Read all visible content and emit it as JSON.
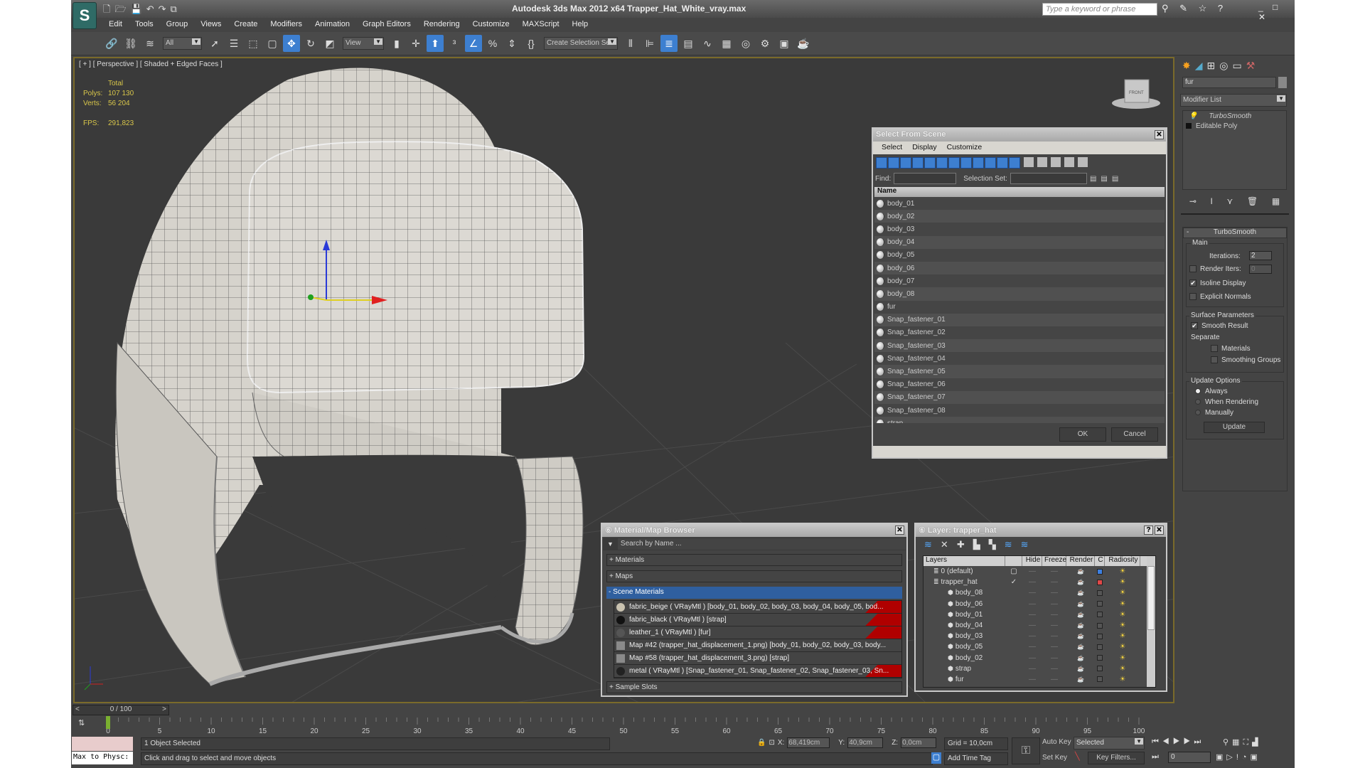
{
  "app": {
    "title": "Autodesk 3ds Max  2012 x64     Trapper_Hat_White_vray.max",
    "logo": "S",
    "search_placeholder": "Type a keyword or phrase",
    "quick_access": [
      "new-file-icon",
      "open-file-icon",
      "save-icon",
      "undo-icon",
      "redo-icon",
      "project-icon"
    ],
    "menu": [
      "Edit",
      "Tools",
      "Group",
      "Views",
      "Create",
      "Modifiers",
      "Animation",
      "Graph Editors",
      "Rendering",
      "Customize",
      "MAXScript",
      "Help"
    ],
    "toolbar": {
      "filter": "All",
      "ref_coord": "View",
      "selection_set": "Create Selection Se"
    }
  },
  "viewport": {
    "label": "[ + ] [ Perspective ] [ Shaded + Edged Faces ]",
    "stats": {
      "total": "Total",
      "polys_label": "Polys:",
      "polys": "107 130",
      "verts_label": "Verts:",
      "verts": "56 204",
      "fps_label": "FPS:",
      "fps": "291,823"
    },
    "viewcube": "FRONT"
  },
  "command_panel": {
    "object_name": "fur",
    "modifier_list": "Modifier List",
    "stack": [
      "TurboSmooth",
      "Editable Poly"
    ],
    "turbosmooth": {
      "title": "TurboSmooth",
      "main": "Main",
      "iterations_label": "Iterations:",
      "iterations": "2",
      "render_iters_label": "Render Iters:",
      "render_iters": "0",
      "isoline": "Isoline Display",
      "isoline_checked": true,
      "explicit_normals": "Explicit Normals",
      "surface": "Surface Parameters",
      "smooth_result": "Smooth Result",
      "separate": "Separate",
      "materials": "Materials",
      "smoothing_groups": "Smoothing Groups",
      "update_options": "Update Options",
      "always": "Always",
      "when_rendering": "When Rendering",
      "manually": "Manually",
      "update": "Update"
    }
  },
  "select_dialog": {
    "title": "Select From Scene",
    "menus": [
      "Select",
      "Display",
      "Customize"
    ],
    "find_label": "Find:",
    "selection_set_label": "Selection Set:",
    "column": "Name",
    "items": [
      "body_01",
      "body_02",
      "body_03",
      "body_04",
      "body_05",
      "body_06",
      "body_07",
      "body_08",
      "fur",
      "Snap_fastener_01",
      "Snap_fastener_02",
      "Snap_fastener_03",
      "Snap_fastener_04",
      "Snap_fastener_05",
      "Snap_fastener_06",
      "Snap_fastener_07",
      "Snap_fastener_08",
      "strap"
    ],
    "ok": "OK",
    "cancel": "Cancel"
  },
  "material_browser": {
    "title": "Material/Map Browser",
    "search_placeholder": "Search by Name ...",
    "groups": [
      "+ Materials",
      "+ Maps"
    ],
    "scene_group": "- Scene Materials",
    "sample_slots": "+ Sample Slots",
    "items": [
      {
        "text": "fabric_beige  ( VRayMtl ) [body_01, body_02, body_03, body_04, body_05, bod...",
        "red": true,
        "swatch": "#c9c2b0"
      },
      {
        "text": "fabric_black  ( VRayMtl ) [strap]",
        "red": true,
        "swatch": "#111111"
      },
      {
        "text": "leather_1  ( VRayMtl ) [fur]",
        "red": true,
        "swatch": "#555555"
      },
      {
        "text": "Map #42 (trapper_hat_displacement_1.png) [body_01, body_02, body_03, body...",
        "red": false,
        "swatch": "#8a8a8a"
      },
      {
        "text": "Map #58 (trapper_hat_displacement_3.png) [strap]",
        "red": false,
        "swatch": "#8a8a8a"
      },
      {
        "text": "metal  ( VRayMtl )  [Snap_fastener_01, Snap_fastener_02, Snap_fastener_03, Sn...",
        "red": true,
        "swatch": "#222222"
      }
    ]
  },
  "layer_manager": {
    "title": "Layer: trapper_hat",
    "columns": [
      "Layers",
      "",
      "Hide",
      "Freeze",
      "Render",
      "C",
      "Radiosity"
    ],
    "rows": [
      {
        "name": "0 (default)",
        "indent": 1,
        "color": "#3d7fe0",
        "flag": "box"
      },
      {
        "name": "trapper_hat",
        "indent": 1,
        "color": "#e04848",
        "flag": "check",
        "expander": "−"
      },
      {
        "name": "body_08",
        "indent": 2,
        "color": "#555555"
      },
      {
        "name": "body_06",
        "indent": 2,
        "color": "#555555"
      },
      {
        "name": "body_01",
        "indent": 2,
        "color": "#555555"
      },
      {
        "name": "body_04",
        "indent": 2,
        "color": "#555555"
      },
      {
        "name": "body_03",
        "indent": 2,
        "color": "#555555"
      },
      {
        "name": "body_05",
        "indent": 2,
        "color": "#555555"
      },
      {
        "name": "body_02",
        "indent": 2,
        "color": "#555555"
      },
      {
        "name": "strap",
        "indent": 2,
        "color": "#555555"
      },
      {
        "name": "fur",
        "indent": 2,
        "color": "#555555"
      }
    ]
  },
  "timeline": {
    "frame": "0 / 100",
    "ticks": [
      "0",
      "5",
      "10",
      "15",
      "20",
      "25",
      "30",
      "35",
      "40",
      "45",
      "50",
      "55",
      "60",
      "65",
      "70",
      "75",
      "80",
      "85",
      "90",
      "95",
      "100"
    ],
    "current": 0
  },
  "status": {
    "maxscript": "Max to Physc:",
    "selected": "1 Object Selected",
    "prompt": "Click and drag to select and move objects",
    "x_label": "X:",
    "x": "68,419cm",
    "y_label": "Y:",
    "y": "40,9cm",
    "z_label": "Z:",
    "z": "0,0cm",
    "grid": "Grid = 10,0cm",
    "add_time_tag": "Add Time Tag",
    "auto_key": "Auto Key",
    "set_key": "Set Key",
    "key_mode": "Selected",
    "key_filters": "Key Filters...",
    "frame_value": "0"
  }
}
